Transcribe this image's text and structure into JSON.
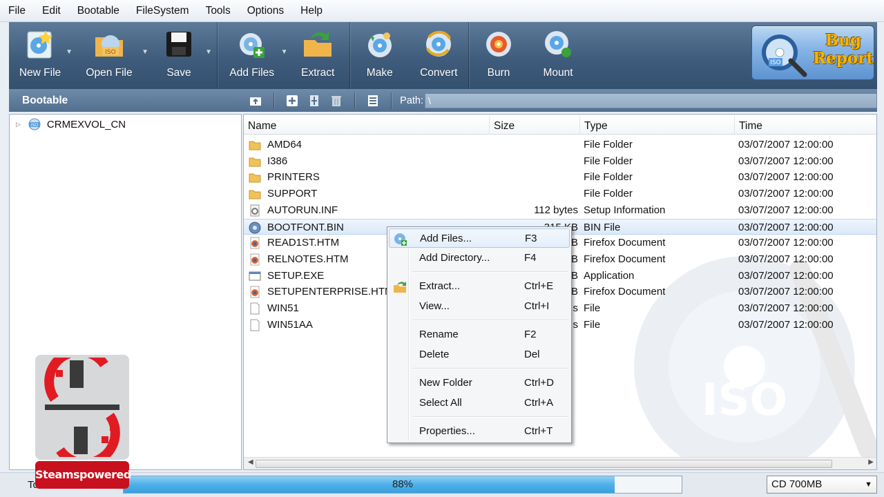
{
  "menu": [
    "File",
    "Edit",
    "Bootable",
    "FileSystem",
    "Tools",
    "Options",
    "Help"
  ],
  "toolbar": {
    "new_file": "New File",
    "open_file": "Open File",
    "save": "Save",
    "add_files": "Add Files",
    "extract": "Extract",
    "make": "Make",
    "convert": "Convert",
    "burn": "Burn",
    "mount": "Mount",
    "bug_report_line1": "Bug",
    "bug_report_line2": "Report"
  },
  "subbar": {
    "bootable": "Bootable",
    "path_label": "Path:",
    "path_value": "\\"
  },
  "tree": {
    "root": "CRMEXVOL_CN"
  },
  "columns": {
    "name": "Name",
    "size": "Size",
    "type": "Type",
    "time": "Time"
  },
  "files": [
    {
      "name": "AMD64",
      "size": "",
      "type": "File Folder",
      "time": "03/07/2007 12:00:00",
      "icon": "folder-icon"
    },
    {
      "name": "I386",
      "size": "",
      "type": "File Folder",
      "time": "03/07/2007 12:00:00",
      "icon": "folder-icon"
    },
    {
      "name": "PRINTERS",
      "size": "",
      "type": "File Folder",
      "time": "03/07/2007 12:00:00",
      "icon": "folder-icon"
    },
    {
      "name": "SUPPORT",
      "size": "",
      "type": "File Folder",
      "time": "03/07/2007 12:00:00",
      "icon": "folder-icon"
    },
    {
      "name": "AUTORUN.INF",
      "size": "112 bytes",
      "type": "Setup Information",
      "time": "03/07/2007 12:00:00",
      "icon": "setup-file-icon"
    },
    {
      "name": "BOOTFONT.BIN",
      "size": "315 KB",
      "type": "BIN File",
      "time": "03/07/2007 12:00:00",
      "icon": "disc-file-icon"
    },
    {
      "name": "READ1ST.HTM",
      "size": "B",
      "type": "Firefox Document",
      "time": "03/07/2007 12:00:00",
      "icon": "firefox-doc-icon"
    },
    {
      "name": "RELNOTES.HTM",
      "size": "B",
      "type": "Firefox Document",
      "time": "03/07/2007 12:00:00",
      "icon": "firefox-doc-icon"
    },
    {
      "name": "SETUP.EXE",
      "size": "B",
      "type": "Application",
      "time": "03/07/2007 12:00:00",
      "icon": "application-icon"
    },
    {
      "name": "SETUPENTERPRISE.HTM",
      "size": "B",
      "type": "Firefox Document",
      "time": "03/07/2007 12:00:00",
      "icon": "firefox-doc-icon"
    },
    {
      "name": "WIN51",
      "size": "s",
      "type": "File",
      "time": "03/07/2007 12:00:00",
      "icon": "blank-file-icon"
    },
    {
      "name": "WIN51AA",
      "size": "s",
      "type": "File",
      "time": "03/07/2007 12:00:00",
      "icon": "blank-file-icon"
    }
  ],
  "context_menu": [
    {
      "label": "Add Files...",
      "key": "F3",
      "icon": "add-files-icon"
    },
    {
      "label": "Add Directory...",
      "key": "F4"
    },
    {
      "label": "Extract...",
      "key": "Ctrl+E",
      "icon": "extract-icon"
    },
    {
      "label": "View...",
      "key": "Ctrl+I"
    },
    {
      "label": "Rename",
      "key": "F2"
    },
    {
      "label": "Delete",
      "key": "Del"
    },
    {
      "label": "New Folder",
      "key": "Ctrl+D"
    },
    {
      "label": "Select All",
      "key": "Ctrl+A"
    },
    {
      "label": "Properties...",
      "key": "Ctrl+T"
    }
  ],
  "status": {
    "label": "To",
    "progress_text": "88%",
    "progress_fraction": 0.88,
    "media": "CD 700MB"
  },
  "watermark": {
    "text": "Steamspowered"
  },
  "colors": {
    "toolbar": "#3f5c7c",
    "selection": "#dbe9f9",
    "progress": "#4fb0e9",
    "watermark_red": "#c8101e"
  }
}
